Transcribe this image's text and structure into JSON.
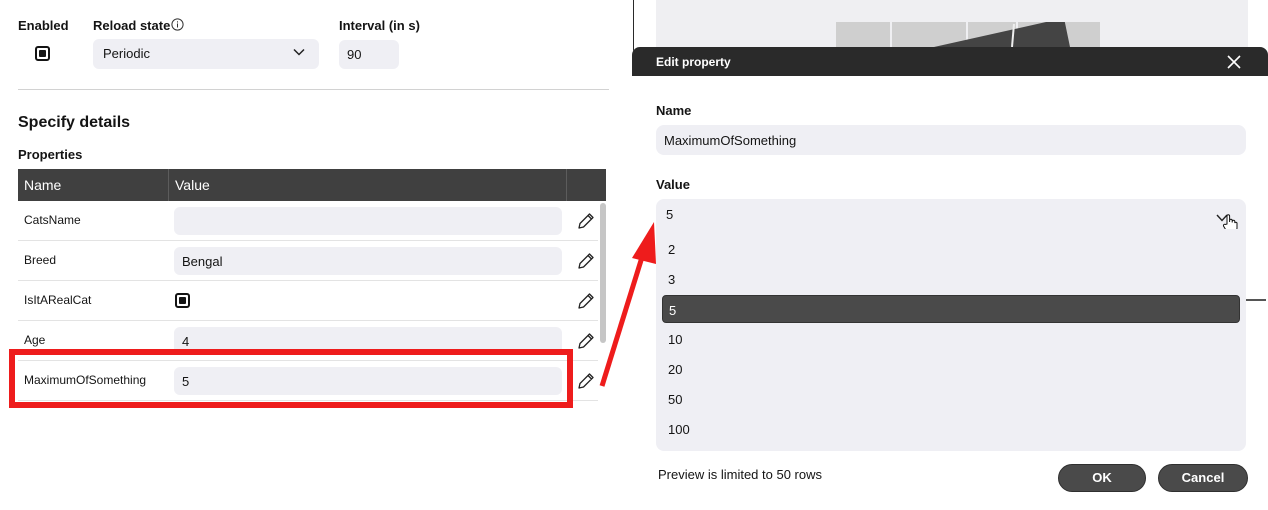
{
  "reload": {
    "enabled_label": "Enabled",
    "reload_state_label": "Reload state",
    "reload_state_value": "Periodic",
    "interval_label": "Interval (in s)",
    "interval_value": "90"
  },
  "details": {
    "title": "Specify details",
    "properties_label": "Properties",
    "columns": [
      "Name",
      "Value"
    ],
    "rows": [
      {
        "name": "CatsName",
        "value": ""
      },
      {
        "name": "Breed",
        "value": "Bengal"
      },
      {
        "name": "IsItARealCat",
        "value": ""
      },
      {
        "name": "Age",
        "value": "4"
      },
      {
        "name": "MaximumOfSomething",
        "value": "5"
      }
    ]
  },
  "dialog": {
    "title": "Edit property",
    "name_label": "Name",
    "name_value": "MaximumOfSomething",
    "value_label": "Value",
    "value_selected": "5",
    "options": [
      "2",
      "3",
      "5",
      "10",
      "20",
      "50",
      "100"
    ],
    "preview_note": "Preview is limited to 50 rows",
    "ok_label": "OK",
    "cancel_label": "Cancel"
  },
  "colors": {
    "annotation": "#ee1c1c",
    "header_dark": "#404040",
    "input_bg": "#efeff4"
  }
}
